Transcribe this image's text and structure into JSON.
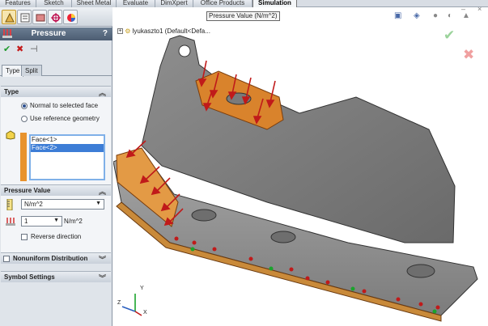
{
  "tabs": [
    "Features",
    "Sketch",
    "Sheet Metal",
    "Evaluate",
    "DimXpert",
    "Office Products",
    "Simulation"
  ],
  "active_tab": "Simulation",
  "pm": {
    "title": "Pressure",
    "help": "?",
    "ok": "✔",
    "cancel": "✖",
    "pin": "⊣"
  },
  "pm_tabs": [
    "Type",
    "Split"
  ],
  "type_group": {
    "label": "Type",
    "opt_normal": "Normal to selected face",
    "opt_ref": "Use reference geometry",
    "faces": [
      "Face<1>",
      "Face<2>"
    ]
  },
  "pressure_group": {
    "label": "Pressure Value",
    "unit": "N/m^2",
    "value": "1",
    "value_unit": "N/m^2",
    "reverse_label": "Reverse direction"
  },
  "nonuniform_label": "Nonuniform Distribution",
  "symbol_label": "Symbol Settings",
  "viewport": {
    "pressure_tag": "Pressure Value (N/m^2)",
    "tree_root": "lyukaszto1 (Default<Defa..."
  },
  "triad": {
    "x": "X",
    "y": "Y",
    "z": "Z"
  },
  "icons": [
    "feature-manager-icon",
    "property-manager-icon",
    "config-manager-icon",
    "dimxpert-icon",
    "display-manager-icon",
    "pressure-icon",
    "face-selection-icon",
    "unit-icon",
    "pressure-value-icon"
  ],
  "colors": {
    "accent": "#4c5d72",
    "selection": "#3d7dd6",
    "face_highlight": "#e8932d",
    "arrow": "#c01a1a",
    "fixture": "#1aa32c"
  }
}
